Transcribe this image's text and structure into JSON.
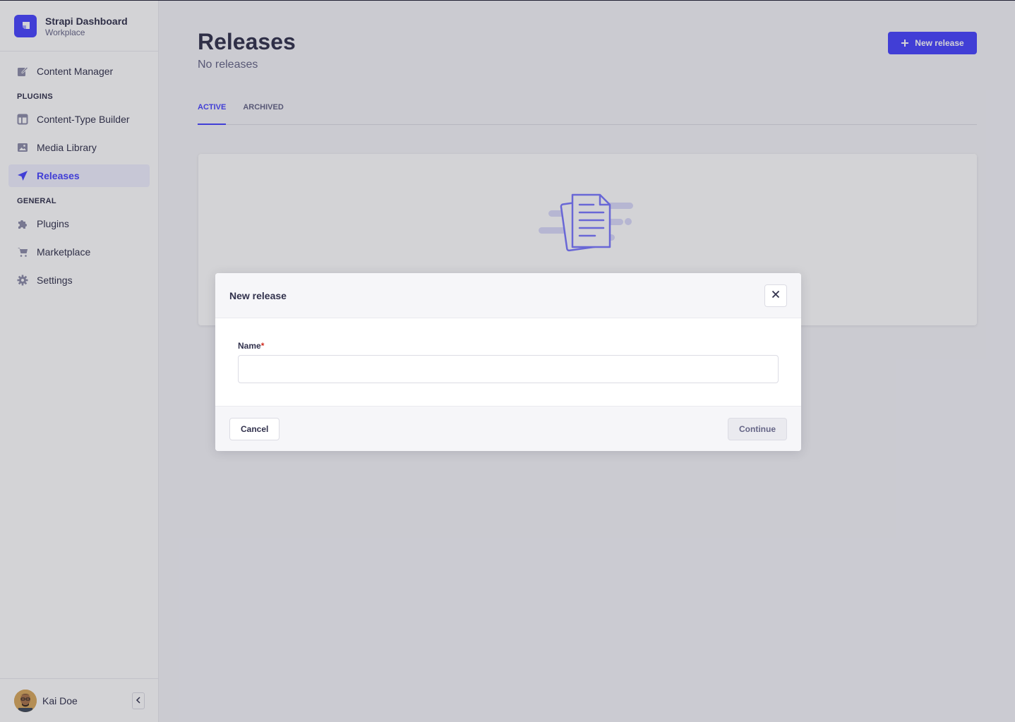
{
  "brand": {
    "title": "Strapi Dashboard",
    "subtitle": "Workplace"
  },
  "sidebar": {
    "top_items": [
      {
        "label": "Content Manager",
        "icon": "pencil-icon"
      }
    ],
    "plugins_heading": "PLUGINS",
    "plugin_items": [
      {
        "label": "Content-Type Builder",
        "icon": "layout-icon"
      },
      {
        "label": "Media Library",
        "icon": "image-icon"
      },
      {
        "label": "Releases",
        "icon": "paper-plane-icon",
        "active": true
      }
    ],
    "general_heading": "GENERAL",
    "general_items": [
      {
        "label": "Plugins",
        "icon": "puzzle-icon"
      },
      {
        "label": "Marketplace",
        "icon": "cart-icon"
      },
      {
        "label": "Settings",
        "icon": "gear-icon"
      }
    ],
    "user": {
      "name": "Kai Doe"
    }
  },
  "page": {
    "title": "Releases",
    "subtitle": "No releases",
    "new_button_label": "New release",
    "tabs": [
      {
        "label": "ACTIVE",
        "active": true
      },
      {
        "label": "ARCHIVED",
        "active": false
      }
    ]
  },
  "modal": {
    "title": "New release",
    "field_label": "Name",
    "required_marker": "*",
    "name_value": "",
    "cancel_label": "Cancel",
    "continue_label": "Continue"
  },
  "colors": {
    "primary": "#4945ff",
    "text": "#32324d",
    "muted": "#666687",
    "danger": "#d02b20"
  }
}
